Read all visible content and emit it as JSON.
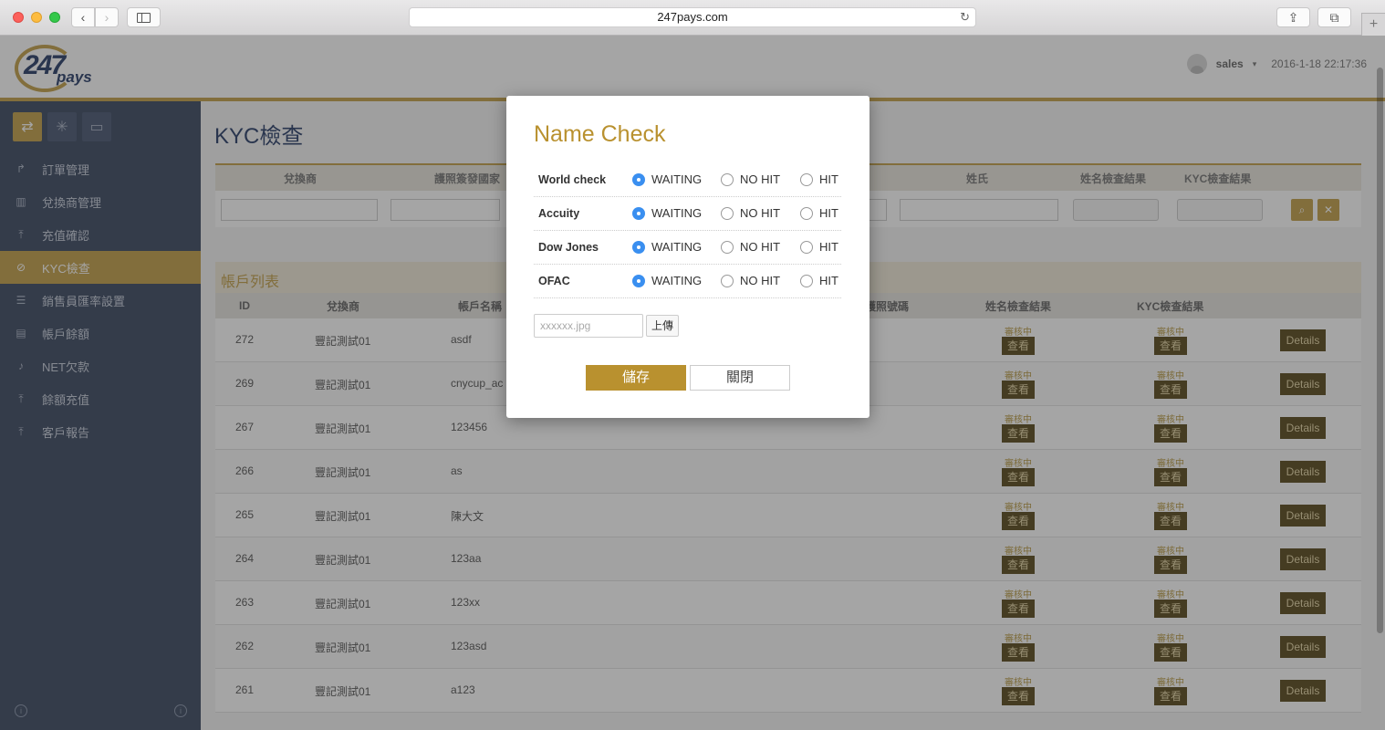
{
  "browser": {
    "url": "247pays.com"
  },
  "header": {
    "logo_number": "247",
    "logo_text": "pays",
    "user": "sales",
    "datetime": "2016-1-18 22:17:36"
  },
  "sidebar": {
    "items": [
      {
        "icon": "share-icon",
        "label": "訂單管理"
      },
      {
        "icon": "building-icon",
        "label": "兌換商管理"
      },
      {
        "icon": "upload-icon",
        "label": "充值確認"
      },
      {
        "icon": "check-circle-icon",
        "label": "KYC檢查",
        "active": true
      },
      {
        "icon": "sliders-icon",
        "label": "銷售員匯率設置"
      },
      {
        "icon": "document-icon",
        "label": "帳戶餘額"
      },
      {
        "icon": "bell-icon",
        "label": "NET欠款"
      },
      {
        "icon": "upload-icon",
        "label": "餘額充值"
      },
      {
        "icon": "upload-icon",
        "label": "客戶報告"
      }
    ]
  },
  "main": {
    "title": "KYC檢查",
    "filters": {
      "col1": "兌換商",
      "col2": "護照簽發國家",
      "col3": "姓氏",
      "col4": "姓名檢查結果",
      "col5": "KYC檢查結果"
    },
    "list_title": "帳戶列表",
    "table": {
      "headers": {
        "id": "ID",
        "exchanger": "兌換商",
        "account": "帳戶名稱",
        "passport": "護照號碼",
        "name_check": "姓名檢查結果",
        "kyc_check": "KYC檢查結果"
      },
      "status_text": "審核中",
      "view_label": "查看",
      "details_label": "Details",
      "rows": [
        {
          "id": "272",
          "exchanger": "豐記測試01",
          "account": "asdf"
        },
        {
          "id": "269",
          "exchanger": "豐記測試01",
          "account": "cnycup_ac"
        },
        {
          "id": "267",
          "exchanger": "豐記測試01",
          "account": "123456"
        },
        {
          "id": "266",
          "exchanger": "豐記測試01",
          "account": "as"
        },
        {
          "id": "265",
          "exchanger": "豐記測試01",
          "account": "陳大文"
        },
        {
          "id": "264",
          "exchanger": "豐記測試01",
          "account": "123aa"
        },
        {
          "id": "263",
          "exchanger": "豐記測試01",
          "account": "123xx"
        },
        {
          "id": "262",
          "exchanger": "豐記測試01",
          "account": "123asd"
        },
        {
          "id": "261",
          "exchanger": "豐記測試01",
          "account": "a123"
        }
      ]
    }
  },
  "modal": {
    "title": "Name Check",
    "options": [
      "WAITING",
      "NO HIT",
      "HIT"
    ],
    "checks": [
      {
        "label": "World check",
        "selected": "WAITING"
      },
      {
        "label": "Accuity",
        "selected": "WAITING"
      },
      {
        "label": "Dow Jones",
        "selected": "WAITING"
      },
      {
        "label": "OFAC",
        "selected": "WAITING"
      }
    ],
    "file_placeholder": "xxxxxx.jpg",
    "upload_label": "上傳",
    "save_label": "儲存",
    "close_label": "關閉"
  }
}
